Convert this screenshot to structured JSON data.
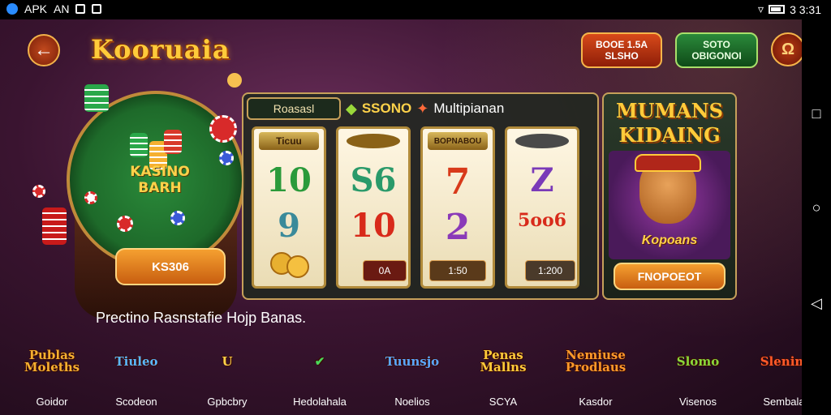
{
  "status_bar": {
    "left_text": "APK",
    "left_icons_text": "AN",
    "right_text": "3 3:31"
  },
  "header": {
    "logo": "Kooruaia",
    "red_button": {
      "line1": "BOOE 1.5A",
      "line2": "SLSHO"
    },
    "green_button": {
      "line1": "SOTO",
      "line2": "OBIGONOI"
    },
    "user_icon": "Ω",
    "back_icon": "←"
  },
  "roulette": {
    "label_line1": "KASINO",
    "label_line2": "BARH",
    "play_button": "KS306"
  },
  "slot": {
    "name": "Roasasl",
    "header_text": "SSONO",
    "multiplier": "Multipianan",
    "reels": [
      {
        "top": "Ticuu",
        "symbols": [
          "10",
          "9"
        ],
        "footer": ""
      },
      {
        "top": "",
        "symbols": [
          "S6",
          "10"
        ],
        "footer": "0A"
      },
      {
        "top": "BOPNABOU",
        "symbols": [
          "7",
          "2"
        ],
        "footer": "1:50"
      },
      {
        "top": "",
        "symbols": [
          "Z",
          "5oo6"
        ],
        "footer": "1:200"
      }
    ]
  },
  "promo": {
    "title_line1": "MUMANS",
    "title_line2": "KIDAING",
    "caption": "Kopoans",
    "button": "FNOPOEOT"
  },
  "section_title": "Prectino Rasnstafie Hojp Banas.",
  "games": [
    {
      "art": "Publas Moleths",
      "label": "Goidor",
      "color": "#f5b030"
    },
    {
      "art": "Tiuleo",
      "label": "Scodeon",
      "color": "#5ab8ff"
    },
    {
      "art": "U",
      "label": "Gpbcbry",
      "color": "#ffd24a"
    },
    {
      "art": "✔",
      "label": "Hedolahala",
      "color": "#4ad85a"
    },
    {
      "art": "Tuunsjo",
      "label": "Noelios",
      "color": "#5aa8ff"
    },
    {
      "art": "Penas Mallns",
      "label": "SCYA",
      "color": "#ffcb3a"
    },
    {
      "art": "Nemiuse Prodlaus",
      "label": "Kasdor",
      "color": "#ff9a2a"
    },
    {
      "art": "Slomo",
      "label": "Visenos",
      "color": "#8ad83a"
    },
    {
      "art": "Slenim",
      "label": "Sembala",
      "color": "#ff5a2a"
    }
  ]
}
